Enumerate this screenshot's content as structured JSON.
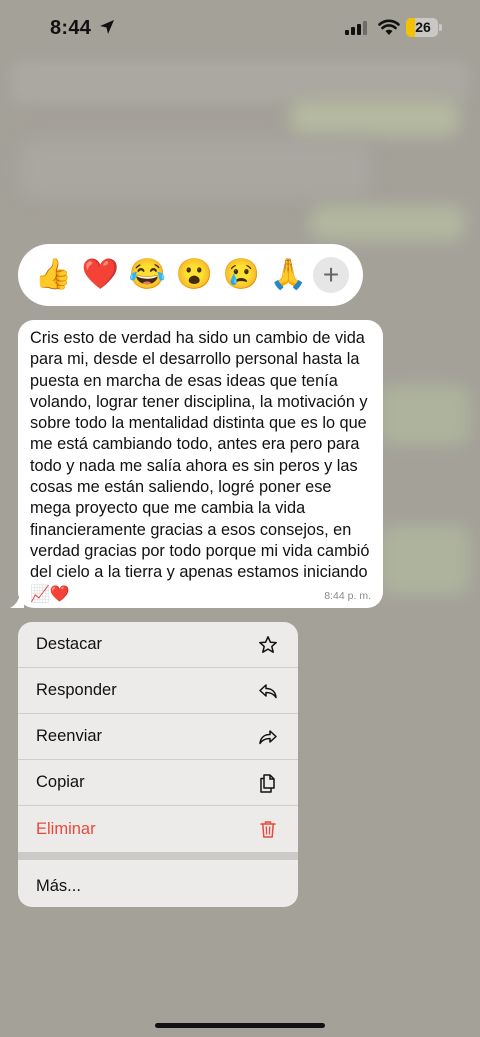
{
  "status_bar": {
    "time": "8:44",
    "battery": "26",
    "location_icon": "location-arrow-icon",
    "signal_icon": "cellular-signal-icon",
    "wifi_icon": "wifi-icon"
  },
  "reactions": [
    {
      "emoji": "👍",
      "name": "thumbs-up"
    },
    {
      "emoji": "❤️",
      "name": "heart"
    },
    {
      "emoji": "😂",
      "name": "laughing"
    },
    {
      "emoji": "😮",
      "name": "surprised"
    },
    {
      "emoji": "😢",
      "name": "crying"
    },
    {
      "emoji": "🙏",
      "name": "praying"
    }
  ],
  "add_reaction": "+",
  "message": {
    "text": "Cris esto de verdad ha sido un cambio de vida para mi, desde el desarrollo personal hasta la puesta en marcha de esas ideas que tenía volando, lograr tener disciplina, la motivación y sobre todo la mentalidad distinta que es lo que me está cambiando todo, antes era pero para todo y nada me salía ahora es sin peros y las cosas me están saliendo, logré poner ese mega proyecto que me cambia la vida financieramente gracias a esos consejos, en verdad gracias por todo porque mi vida cambió del cielo a la tierra y apenas estamos iniciando",
    "trailing_emojis": "📈❤️",
    "time": "8:44 p. m."
  },
  "menu": {
    "items": [
      {
        "label": "Destacar",
        "icon": "star-icon"
      },
      {
        "label": "Responder",
        "icon": "reply-icon"
      },
      {
        "label": "Reenviar",
        "icon": "forward-icon"
      },
      {
        "label": "Copiar",
        "icon": "copy-icon"
      },
      {
        "label": "Eliminar",
        "icon": "trash-icon",
        "color": "#e74a3b"
      }
    ],
    "more_label": "Más..."
  },
  "colors": {
    "danger": "#e74a3b",
    "battery_fill": "#f2c200",
    "bubble": "#ffffff"
  }
}
